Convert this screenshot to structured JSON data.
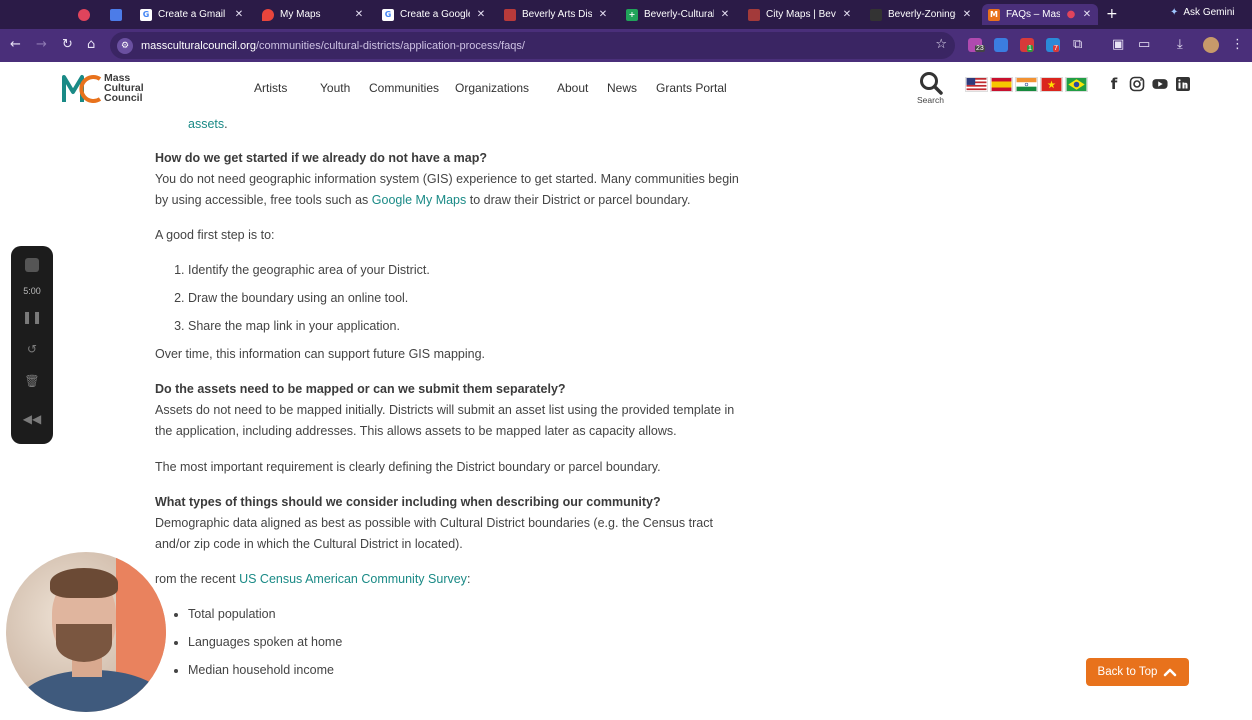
{
  "browser": {
    "tabs": [
      {
        "title": "",
        "favicon_color": "#e0445c",
        "favicon_glyph": "●"
      },
      {
        "title": "",
        "favicon_color": "#4c7ce8",
        "favicon_glyph": "✱"
      },
      {
        "title": "Create a Gmail a",
        "favicon_color": "#ffffff",
        "favicon_glyph": "G"
      },
      {
        "title": "My Maps",
        "favicon_color": "#e8453c",
        "favicon_glyph": "◉"
      },
      {
        "title": "Create a Google",
        "favicon_color": "#ffffff",
        "favicon_glyph": "G"
      },
      {
        "title": "Beverly Arts Dist",
        "favicon_color": "#b83a3a",
        "favicon_glyph": "■"
      },
      {
        "title": "Beverly-Cultural",
        "favicon_color": "#21a35a",
        "favicon_glyph": "+"
      },
      {
        "title": "City Maps | Beve",
        "favicon_color": "#a33a3a",
        "favicon_glyph": "■"
      },
      {
        "title": "Beverly-Zoning-",
        "favicon_color": "#333333",
        "favicon_glyph": "▪"
      },
      {
        "title": "FAQs – Mass",
        "favicon_color": "#e8721c",
        "favicon_glyph": "M"
      }
    ],
    "new_tab_label": "+",
    "ask_gemini": "Ask Gemini",
    "url_domain": "massculturalcouncil.org",
    "url_path": "/communities/cultural-districts/application-process/faqs/",
    "extension_badges": [
      "23",
      "1",
      "7"
    ]
  },
  "site": {
    "logo": {
      "line1": "Mass",
      "line2": "Cultural",
      "line3": "Council"
    },
    "nav": [
      "Artists",
      "Youth",
      "Communities",
      "Organizations",
      "About",
      "News",
      "Grants Portal"
    ],
    "search_label": "Search",
    "flags": [
      "us-flag",
      "spain-flag",
      "india-flag",
      "vietnam-flag",
      "brazil-flag"
    ],
    "social": [
      "facebook",
      "instagram",
      "youtube",
      "linkedin"
    ]
  },
  "content": {
    "top_link": "assets",
    "top_link_suffix": ".",
    "q1": "How do we get started if we already do not have a map?",
    "q1_p1_before": "You do not need geographic information system (GIS) experience to get started. Many communities begin by using accessible, free tools such as ",
    "q1_p1_link": "Google My Maps",
    "q1_p1_after": " to draw their District or parcel boundary.",
    "q1_p2": "A good first step is to:",
    "q1_steps": [
      "Identify the geographic area of your District.",
      "Draw the boundary using an online tool.",
      "Share the map link in your application."
    ],
    "q1_p3": "Over time, this information can support future GIS mapping.",
    "q2": "Do the assets need to be mapped or can we submit them separately?",
    "q2_p1": "Assets do not need to be mapped initially. Districts will submit an asset list using the provided template in the application, including addresses. This allows assets to be mapped later as capacity allows.",
    "q2_p2": "The most important requirement is clearly defining the District boundary or parcel boundary.",
    "q3": "What types of things should we consider including when describing our community?",
    "q3_p1": "Demographic data aligned as best as possible with Cultural District boundaries (e.g. the Census tract and/or zip code in which the Cultural District in located).",
    "q3_p2_before": "rom the recent ",
    "q3_p2_link": "US Census American Community Survey",
    "q3_p2_after": ":",
    "q3_list": [
      "Total population",
      "Languages spoken at home",
      "Median household income"
    ]
  },
  "recorder": {
    "time": "5:00"
  },
  "back_to_top": "Back to Top"
}
